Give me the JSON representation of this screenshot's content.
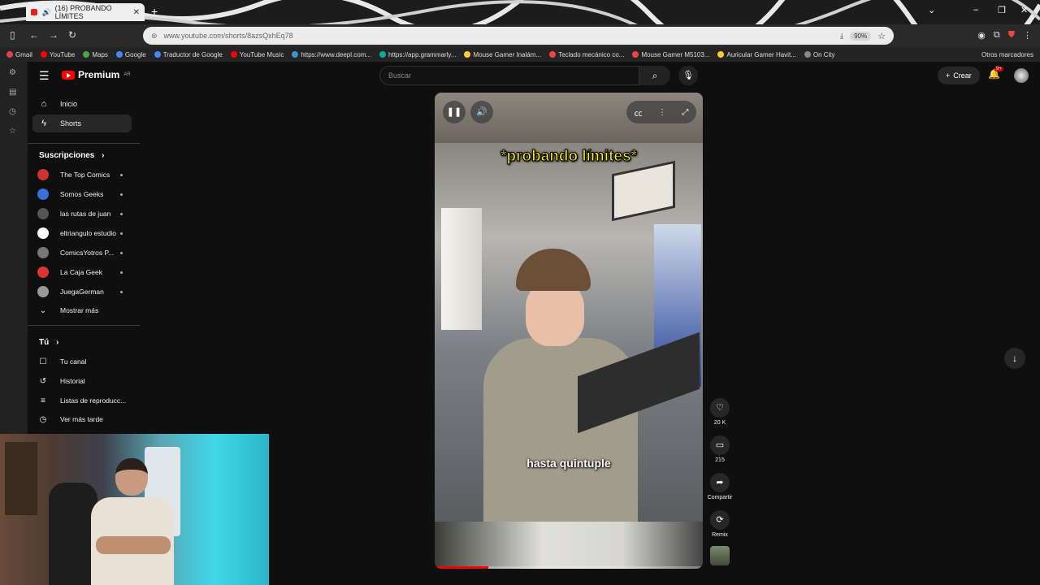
{
  "browser": {
    "tab_title": "(16) PROBANDO LÍMITES",
    "tab_close": "✕",
    "new_tab": "+",
    "url": "www.youtube.com/shorts/8azsQxhEq78",
    "zoom": "90%",
    "ext_badge": "146",
    "bookmarks": [
      {
        "label": "Gmail",
        "color": "#d44"
      },
      {
        "label": "YouTube",
        "color": "#f00"
      },
      {
        "label": "Maps",
        "color": "#4a4"
      },
      {
        "label": "Google",
        "color": "#48f"
      },
      {
        "label": "Traductor de Google",
        "color": "#48f"
      },
      {
        "label": "YouTube Music",
        "color": "#f00"
      },
      {
        "label": "https://www.deepl.com...",
        "color": "#39c"
      },
      {
        "label": "https://app.grammarly...",
        "color": "#1a9"
      },
      {
        "label": "Mouse Gamer Inalám...",
        "color": "#fc3"
      },
      {
        "label": "Teclado mecánico co...",
        "color": "#e44"
      },
      {
        "label": "Mouse Gamer M5103...",
        "color": "#e44"
      },
      {
        "label": "Auricular Gamer Havit...",
        "color": "#fc3"
      },
      {
        "label": "On City",
        "color": "#888"
      }
    ],
    "other_bookmarks": "Otros marcadores"
  },
  "header": {
    "logo_text": "Premium",
    "logo_region": "AR",
    "search_placeholder": "Buscar",
    "create_label": "Crear",
    "notif_badge": "9+"
  },
  "sidebar": {
    "items": [
      {
        "label": "Inicio",
        "icon": "home-icon"
      },
      {
        "label": "Shorts",
        "icon": "shorts-icon"
      }
    ],
    "subs_title": "Suscripciones",
    "subscriptions": [
      {
        "label": "The Top Comics",
        "color": "#c33"
      },
      {
        "label": "Somos Geeks",
        "color": "#3a6fd8"
      },
      {
        "label": "las rutas de juan",
        "color": "#555"
      },
      {
        "label": "eltriangulo estudio",
        "color": "#fff"
      },
      {
        "label": "ComicsYotros P...",
        "color": "#777"
      },
      {
        "label": "La Caja Geek",
        "color": "#d33"
      },
      {
        "label": "JuegaGerman",
        "color": "#999"
      }
    ],
    "show_more": "Mostrar más",
    "you_title": "Tú",
    "you_items": [
      {
        "label": "Tu canal"
      },
      {
        "label": "Historial"
      },
      {
        "label": "Listas de reproducc..."
      },
      {
        "label": "Ver más tarde"
      }
    ]
  },
  "video": {
    "caption_top": "*probando límites*",
    "caption_bottom": "hasta quintuple",
    "progress": 0.2
  },
  "actions": {
    "likes": "20 K",
    "comments": "215",
    "share": "Compartir",
    "remix": "Remix"
  }
}
